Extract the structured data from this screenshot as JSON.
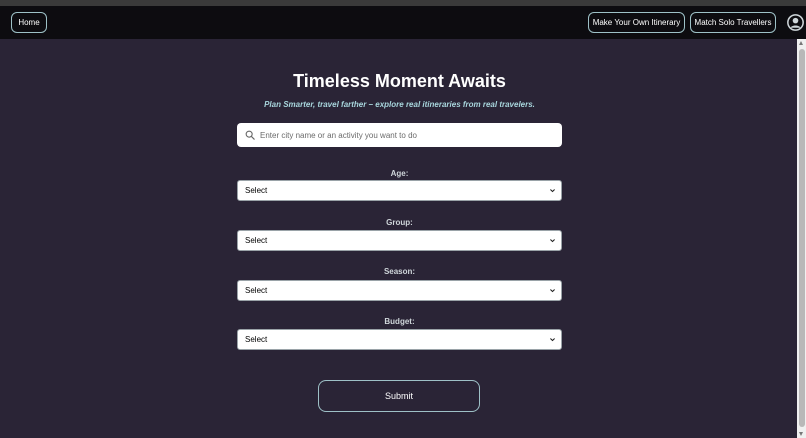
{
  "nav": {
    "home_label": "Home",
    "own_itinerary_label": "Make Your Own Itinerary",
    "match_label": "Match Solo Travellers"
  },
  "hero": {
    "title": "Timeless Moment Awaits",
    "subtitle": "Plan Smarter, travel farther – explore real itineraries from real travelers."
  },
  "search": {
    "placeholder": "Enter city name or an activity you want to do"
  },
  "filters": [
    {
      "label": "Age:",
      "value": "Select"
    },
    {
      "label": "Group:",
      "value": "Select"
    },
    {
      "label": "Season:",
      "value": "Select"
    },
    {
      "label": "Budget:",
      "value": "Select"
    }
  ],
  "submit_label": "Submit",
  "colors": {
    "background": "#2a2436",
    "navbar": "#0d0c10",
    "accent_border": "#9ec1c7",
    "subtitle": "#a8d6dd"
  },
  "icons": [
    "user-avatar-icon",
    "search-icon",
    "chevron-down-icon"
  ]
}
